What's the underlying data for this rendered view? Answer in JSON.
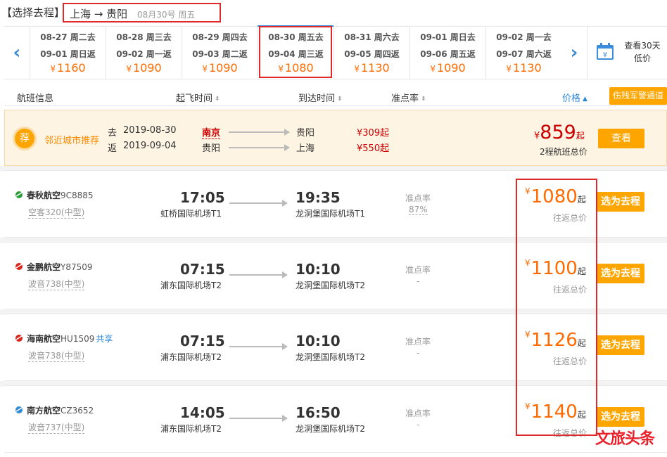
{
  "title": {
    "label": "【选择去程】",
    "route": "上海 → 贵阳",
    "date": "08月30号 周五"
  },
  "date_strip": {
    "cells": [
      {
        "go": "08-27 周二去",
        "back": "09-01 周日返",
        "price": "1160",
        "selected": false
      },
      {
        "go": "08-28 周三去",
        "back": "09-02 周一返",
        "price": "1090",
        "selected": false
      },
      {
        "go": "08-29 周四去",
        "back": "09-03 周二返",
        "price": "1090",
        "selected": false
      },
      {
        "go": "08-30 周五去",
        "back": "09-04 周三返",
        "price": "1080",
        "selected": true
      },
      {
        "go": "08-31 周六去",
        "back": "09-05 周四返",
        "price": "1130",
        "selected": false
      },
      {
        "go": "09-01 周日去",
        "back": "09-06 周五返",
        "price": "1090",
        "selected": false
      },
      {
        "go": "09-02 周一去",
        "back": "09-07 周六返",
        "price": "1130",
        "selected": false
      }
    ],
    "currency": "¥",
    "calendar_line1": "查看30天",
    "calendar_line2": "低价",
    "left_arrow": "‹",
    "right_arrow": "›"
  },
  "header": {
    "flight_info": "航班信息",
    "dep_time": "起飞时间",
    "arr_time": "到达时间",
    "punctuality": "准点率",
    "price": "价格",
    "disabled_channel": "伤残军警通道"
  },
  "recommend": {
    "badge": "荐",
    "title": "邻近城市推荐",
    "go_label": "去",
    "go_date": "2019-08-30",
    "go_from": "南京",
    "go_to": "贵阳",
    "go_price": "¥309起",
    "back_label": "返",
    "back_date": "2019-09-04",
    "back_from": "贵阳",
    "back_to": "上海",
    "back_price": "¥550起",
    "total_currency": "¥",
    "total": "859",
    "total_suffix": "起",
    "total_label": "2程航班总价",
    "button": "查看"
  },
  "flights": [
    {
      "airline": "春秋航空",
      "flight_no": "9C8885",
      "share": "",
      "plane": "空客320(中型)",
      "dep_time": "17:05",
      "dep_airport": "虹桥国际机场T1",
      "arr_time": "19:35",
      "arr_airport": "龙洞堡国际机场T1",
      "punct_label": "准点率",
      "punctuality": "87%",
      "price": "1080",
      "price_suffix": "起",
      "price_label": "往返总价",
      "button": "选为去程",
      "logo_color": "#2a9d3a"
    },
    {
      "airline": "金鹏航空",
      "flight_no": "Y87509",
      "share": "",
      "plane": "波音738(中型)",
      "dep_time": "07:15",
      "dep_airport": "浦东国际机场T2",
      "arr_time": "10:10",
      "arr_airport": "龙洞堡国际机场T2",
      "punct_label": "准点率",
      "punctuality": "-",
      "price": "1100",
      "price_suffix": "起",
      "price_label": "往返总价",
      "button": "选为去程",
      "logo_color": "#d9261c"
    },
    {
      "airline": "海南航空",
      "flight_no": "HU1509",
      "share": "共享",
      "plane": "波音738(中型)",
      "dep_time": "07:15",
      "dep_airport": "浦东国际机场T2",
      "arr_time": "10:10",
      "arr_airport": "龙洞堡国际机场T2",
      "punct_label": "准点率",
      "punctuality": "-",
      "price": "1126",
      "price_suffix": "起",
      "price_label": "往返总价",
      "button": "选为去程",
      "logo_color": "#d9261c"
    },
    {
      "airline": "南方航空",
      "flight_no": "CZ3652",
      "share": "",
      "plane": "波音737(中型)",
      "dep_time": "14:05",
      "dep_airport": "浦东国际机场T2",
      "arr_time": "16:50",
      "arr_airport": "龙洞堡国际机场T2",
      "punct_label": "准点率",
      "punctuality": "-",
      "price": "1140",
      "price_suffix": "起",
      "price_label": "往返总价",
      "button": "选为去程",
      "logo_color": "#2e89d8"
    }
  ],
  "currency": "¥",
  "watermark": "文旅头条",
  "colors": {
    "accent": "#ff6a00",
    "button": "#ffa500",
    "highlight": "#e02a2a",
    "link": "#2e89d8"
  }
}
